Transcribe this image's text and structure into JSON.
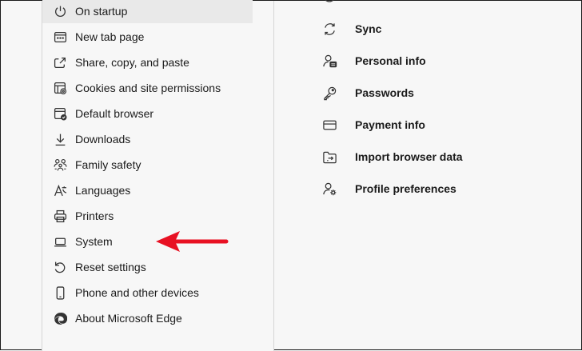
{
  "sidebar": {
    "items": [
      {
        "label": "On startup",
        "icon": "power-icon"
      },
      {
        "label": "New tab page",
        "icon": "new-tab-icon"
      },
      {
        "label": "Share, copy, and paste",
        "icon": "share-icon"
      },
      {
        "label": "Cookies and site permissions",
        "icon": "cookies-icon"
      },
      {
        "label": "Default browser",
        "icon": "default-browser-icon"
      },
      {
        "label": "Downloads",
        "icon": "download-icon"
      },
      {
        "label": "Family safety",
        "icon": "family-icon"
      },
      {
        "label": "Languages",
        "icon": "languages-icon"
      },
      {
        "label": "Printers",
        "icon": "printer-icon"
      },
      {
        "label": "System",
        "icon": "laptop-icon"
      },
      {
        "label": "Reset settings",
        "icon": "reset-icon"
      },
      {
        "label": "Phone and other devices",
        "icon": "phone-icon"
      },
      {
        "label": "About Microsoft Edge",
        "icon": "edge-logo-icon"
      }
    ]
  },
  "profile": {
    "items": [
      {
        "label": "Sync",
        "icon": "sync-icon"
      },
      {
        "label": "Personal info",
        "icon": "personal-info-icon"
      },
      {
        "label": "Passwords",
        "icon": "key-icon"
      },
      {
        "label": "Payment info",
        "icon": "credit-card-icon"
      },
      {
        "label": "Import browser data",
        "icon": "import-icon"
      },
      {
        "label": "Profile preferences",
        "icon": "profile-preferences-icon"
      }
    ]
  },
  "annotation": {
    "arrow_color": "#e81123"
  }
}
